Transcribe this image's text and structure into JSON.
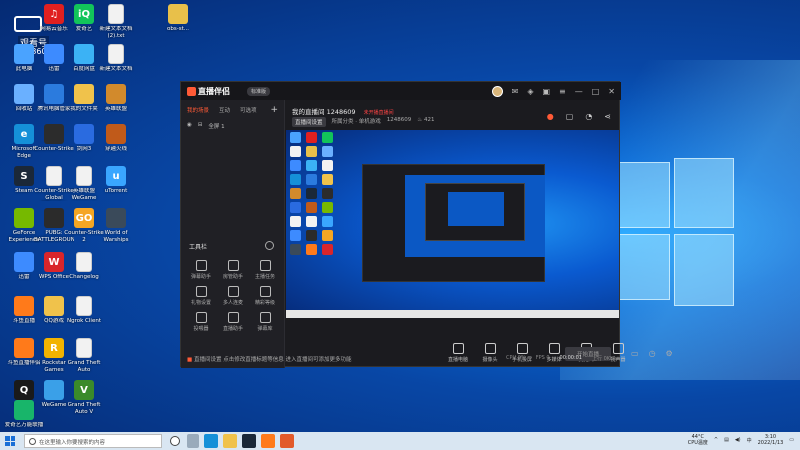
{
  "desktop": {
    "badge": {
      "line1": "观看号",
      "line2": "1248609"
    },
    "icons": [
      {
        "label": "此电脑",
        "color": "#4aa3ff"
      },
      {
        "label": "网易云音乐",
        "color": "#e02020",
        "glyph": "♫"
      },
      {
        "label": "爱奇艺",
        "color": "#12c45a",
        "glyph": "iQ"
      },
      {
        "label": "新建文本文档 (2).txt",
        "color": "#f2f2f2"
      },
      {
        "label": "obs-st...",
        "color": "#e8c04a"
      },
      {
        "label": "回收站",
        "color": "#6ab0ff"
      },
      {
        "label": "迅雷",
        "color": "#3d8bff"
      },
      {
        "label": "百度网盘",
        "color": "#3bb2f5"
      },
      {
        "label": "新建文本文档",
        "color": "#f2f2f2"
      },
      {
        "label": "Microsoft Edge",
        "color": "#1590d8",
        "glyph": "e"
      },
      {
        "label": "腾讯电脑管家",
        "color": "#2b7bde"
      },
      {
        "label": "我的文件夹",
        "color": "#f0c24b"
      },
      {
        "label": "英雄联盟",
        "color": "#d28a2c"
      },
      {
        "label": "Steam",
        "color": "#1b2838",
        "glyph": "S"
      },
      {
        "label": "Counter-Strike",
        "color": "#2c2c2c"
      },
      {
        "label": "剑网3",
        "color": "#2a6be0"
      },
      {
        "label": "穿越火线",
        "color": "#c05a1a"
      },
      {
        "label": "GeForce Experience",
        "color": "#76b900"
      },
      {
        "label": "Counter-Strike Global Offensive",
        "color": "#f2f2f2"
      },
      {
        "label": "英雄联盟 WeGame",
        "color": "#f2f2f2"
      },
      {
        "label": "uTorrent",
        "color": "#3aa6ff",
        "glyph": "u"
      },
      {
        "label": "迅雷",
        "color": "#3d8bff"
      },
      {
        "label": "PUBG: BATTLEGROUNDS",
        "color": "#2b2b2b"
      },
      {
        "label": "Counter-Strike 2",
        "color": "#f5a623",
        "glyph": "GO"
      },
      {
        "label": "World of Warships",
        "color": "#3a4a5a"
      },
      {
        "label": "斗鱼直播",
        "color": "#ff7a1a"
      },
      {
        "label": "WPS Office",
        "color": "#d9252b",
        "glyph": "W"
      },
      {
        "label": "Changelog",
        "color": "#f2f2f2"
      },
      {
        "label": "斗鱼直播伴侣",
        "color": "#ff7a1a"
      },
      {
        "label": "QQ游戏",
        "color": "#f0c24b"
      },
      {
        "label": "Ngrok Client",
        "color": "#f2f2f2"
      },
      {
        "label": "腾讯QQ",
        "color": "#1a1a1a",
        "glyph": "Q"
      },
      {
        "label": "Rockstar Games",
        "color": "#f2b300",
        "glyph": "R"
      },
      {
        "label": "Grand Theft Auto",
        "color": "#f2f2f2"
      },
      {
        "label": "爱奇艺万能联播",
        "color": "#18b56a"
      },
      {
        "label": "WeGame",
        "color": "#3aa0e8"
      },
      {
        "label": "Grand Theft Auto V",
        "color": "#3a8a2a",
        "glyph": "V"
      }
    ]
  },
  "app": {
    "name": "直播伴侣",
    "version": "标准版",
    "left_tabs": [
      "我的场景",
      "互动",
      "可选项"
    ],
    "scene_label": "全屏 1",
    "tools_heading": "工具栏",
    "tools": [
      "弹幕助手",
      "房管助手",
      "主播任务",
      "礼物设置",
      "多人连麦",
      "精彩等级",
      "投喂器",
      "直播助手",
      "弹幕库"
    ],
    "room_title": "我的直播间 1248609",
    "room_status": "未开播直播间",
    "room_tag": "直播间设置",
    "room_meta": "所属分类 · 单机游戏",
    "room_id": "1248609",
    "room_hot": "421",
    "controls": [
      "直播电脑",
      "摄像头",
      "手机投屏",
      "多媒体",
      "麦克风",
      "扬声器"
    ],
    "start_button": "开始直播",
    "stats": {
      "cpu": "CPU 0%",
      "fps": "FPS 0",
      "time": "00:00:01",
      "net": "上行 0Kb/s"
    },
    "notice": "直播间设置 点击修改直播标题等信息 进入直播间可添加更多功能"
  },
  "taskbar": {
    "search_placeholder": "在这里输入你要搜索的内容",
    "weather": "44°C",
    "weather_desc": "CPU温度",
    "time": "3:10",
    "date": "2022/1/13"
  }
}
